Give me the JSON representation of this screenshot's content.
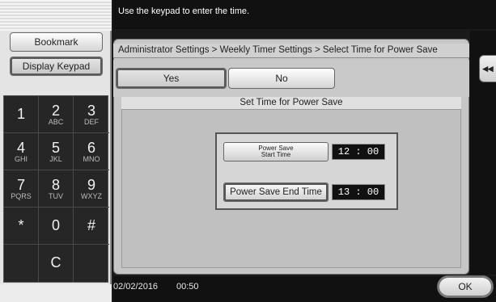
{
  "message": "Use the keypad to enter the time.",
  "left": {
    "bookmark_label": "Bookmark",
    "display_keypad_label": "Display Keypad",
    "keys": [
      {
        "num": "1",
        "sub": ""
      },
      {
        "num": "2",
        "sub": "ABC"
      },
      {
        "num": "3",
        "sub": "DEF"
      },
      {
        "num": "4",
        "sub": "GHI"
      },
      {
        "num": "5",
        "sub": "JKL"
      },
      {
        "num": "6",
        "sub": "MNO"
      },
      {
        "num": "7",
        "sub": "PQRS"
      },
      {
        "num": "8",
        "sub": "TUV"
      },
      {
        "num": "9",
        "sub": "WXYZ"
      },
      {
        "num": "*",
        "sub": ""
      },
      {
        "num": "0",
        "sub": ""
      },
      {
        "num": "#",
        "sub": ""
      },
      {
        "num": "",
        "sub": ""
      },
      {
        "num": "C",
        "sub": ""
      },
      {
        "num": "",
        "sub": ""
      }
    ]
  },
  "breadcrumb": "Administrator Settings > Weekly Timer Settings > Select Time for Power Save",
  "tabs": {
    "yes": "Yes",
    "no": "No"
  },
  "content": {
    "title": "Set Time for Power Save",
    "start_label_line1": "Power Save",
    "start_label_line2": "Start Time",
    "start_value": "12 : 00",
    "end_label": "Power Save End Time",
    "end_value": "13 : 00"
  },
  "collapse_label": "◂◂",
  "status": {
    "date": "02/02/2016",
    "time": "00:50",
    "ok_label": "OK"
  }
}
